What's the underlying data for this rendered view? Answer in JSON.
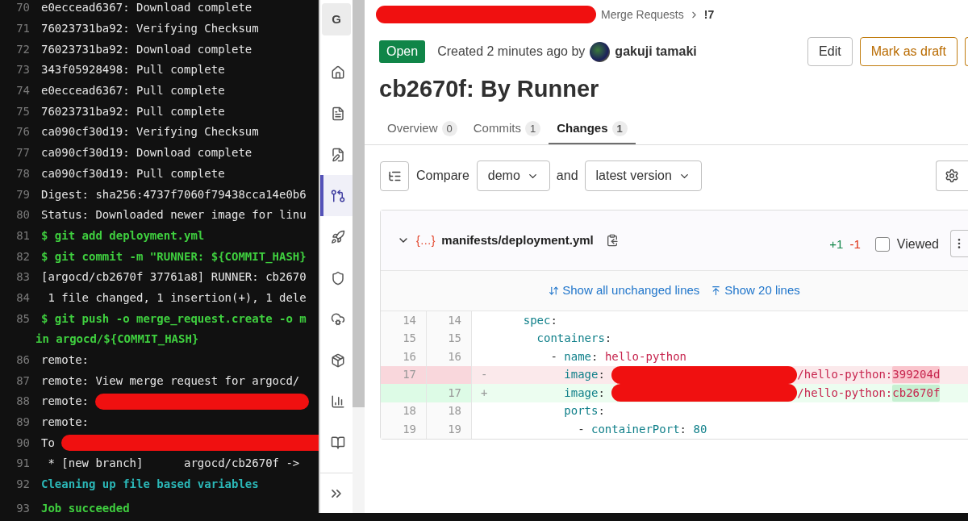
{
  "terminal": {
    "lines": [
      {
        "number": "70",
        "text": "e0eccead6367: Download complete",
        "kind": "plain"
      },
      {
        "number": "71",
        "text": "76023731ba92: Verifying Checksum",
        "kind": "plain"
      },
      {
        "number": "72",
        "text": "76023731ba92: Download complete",
        "kind": "plain"
      },
      {
        "number": "73",
        "text": "343f05928498: Pull complete",
        "kind": "plain"
      },
      {
        "number": "74",
        "text": "e0eccead6367: Pull complete",
        "kind": "plain"
      },
      {
        "number": "75",
        "text": "76023731ba92: Pull complete",
        "kind": "plain"
      },
      {
        "number": "76",
        "text": "ca090cf30d19: Verifying Checksum",
        "kind": "plain"
      },
      {
        "number": "77",
        "text": "ca090cf30d19: Download complete",
        "kind": "plain"
      },
      {
        "number": "78",
        "text": "ca090cf30d19: Pull complete",
        "kind": "plain"
      },
      {
        "number": "79",
        "text": "Digest: sha256:4737f7060f79438cca14e0b6",
        "kind": "plain"
      },
      {
        "number": "80",
        "text": "Status: Downloaded newer image for linu",
        "kind": "plain"
      },
      {
        "number": "81",
        "text": "$ git add deployment.yml",
        "kind": "command"
      },
      {
        "number": "82",
        "text": "$ git commit -m \"RUNNER: ${COMMIT_HASH}",
        "kind": "command"
      },
      {
        "number": "83",
        "text": "[argocd/cb2670f 37761a8] RUNNER: cb2670",
        "kind": "plain"
      },
      {
        "number": "84",
        "text": " 1 file changed, 1 insertion(+), 1 dele",
        "kind": "plain"
      },
      {
        "number": "85",
        "text": "$ git push -o merge_request.create -o m",
        "kind": "command",
        "continuation": "in argocd/${COMMIT_HASH}"
      },
      {
        "number": "86",
        "text": "remote:",
        "kind": "plain"
      },
      {
        "number": "87",
        "text": "remote: View merge request for argocd/",
        "kind": "plain"
      },
      {
        "number": "88",
        "text": "remote:",
        "kind": "plain",
        "redacted": true
      },
      {
        "number": "89",
        "text": "remote:",
        "kind": "plain"
      },
      {
        "number": "90",
        "text": "To",
        "kind": "plain",
        "redacted": true
      },
      {
        "number": "91",
        "text": " * [new branch]      argocd/cb2670f ->",
        "kind": "plain"
      },
      {
        "number": "92",
        "text": "Cleaning up file based variables",
        "kind": "section"
      },
      {
        "number": "93",
        "text": "Job succeeded",
        "kind": "success"
      }
    ]
  },
  "sidebar": {
    "logo": "G",
    "items": [
      {
        "selected": false
      },
      {
        "selected": false
      },
      {
        "selected": false
      },
      {
        "selected": true
      },
      {
        "selected": false
      },
      {
        "selected": false
      },
      {
        "selected": false
      },
      {
        "selected": false
      },
      {
        "selected": false
      },
      {
        "selected": false
      }
    ]
  },
  "breadcrumb": {
    "redacted": true,
    "items": [
      "Merge Requests",
      "!7"
    ]
  },
  "merge_request": {
    "status": "Open",
    "created": "Created 2 minutes ago by",
    "author": "gakuji tamaki",
    "title": "cb2670f: By Runner",
    "buttons": [
      {
        "label": "Edit",
        "kind": "default"
      },
      {
        "label": "Mark as draft",
        "kind": "warning"
      }
    ]
  },
  "tabs": [
    {
      "label": "Overview",
      "count": "0",
      "selected": false
    },
    {
      "label": "Commits",
      "count": "1",
      "selected": false
    },
    {
      "label": "Changes",
      "count": "1",
      "selected": true
    }
  ],
  "compare": {
    "label": "Compare",
    "base": "demo",
    "joiner": "and",
    "head": "latest version"
  },
  "file": {
    "icon": "{…}",
    "path": "manifests/deployment.yml",
    "added": "+1",
    "removed": "-1",
    "viewed": {
      "label": "Viewed",
      "checked": false
    },
    "expand_links": [
      "Show all unchanged lines",
      "Show 20 lines"
    ],
    "lines": [
      {
        "old": "14",
        "new": "14",
        "kind": "context",
        "segments": [
          {
            "text": "    spec",
            "kind": "key"
          },
          {
            "text": ":",
            "kind": "plain"
          }
        ]
      },
      {
        "old": "15",
        "new": "15",
        "kind": "context",
        "segments": [
          {
            "text": "      containers",
            "kind": "key"
          },
          {
            "text": ":",
            "kind": "plain"
          }
        ]
      },
      {
        "old": "16",
        "new": "16",
        "kind": "context",
        "segments": [
          {
            "text": "        - ",
            "kind": "plain"
          },
          {
            "text": "name",
            "kind": "key"
          },
          {
            "text": ": ",
            "kind": "plain"
          },
          {
            "text": "hello-python",
            "kind": "value"
          }
        ]
      },
      {
        "old": "17",
        "kind": "removed",
        "sign": "-",
        "segments": [
          {
            "text": "          image",
            "kind": "key"
          },
          {
            "text": ": ",
            "kind": "plain"
          },
          {
            "kind": "redacted"
          },
          {
            "text": "/hello-python:",
            "kind": "value"
          },
          {
            "text": "399204d",
            "kind": "changed"
          }
        ]
      },
      {
        "new": "17",
        "kind": "added",
        "sign": "+",
        "segments": [
          {
            "text": "          image",
            "kind": "key"
          },
          {
            "text": ": ",
            "kind": "plain"
          },
          {
            "kind": "redacted"
          },
          {
            "text": "/hello-python:",
            "kind": "value"
          },
          {
            "text": "cb2670f",
            "kind": "changed"
          }
        ]
      },
      {
        "old": "18",
        "new": "18",
        "kind": "context",
        "segments": [
          {
            "text": "          ports",
            "kind": "key"
          },
          {
            "text": ":",
            "kind": "plain"
          }
        ]
      },
      {
        "old": "19",
        "new": "19",
        "kind": "context",
        "segments": [
          {
            "text": "            - ",
            "kind": "plain"
          },
          {
            "text": "containerPort",
            "kind": "key"
          },
          {
            "text": ": ",
            "kind": "plain"
          },
          {
            "text": "80",
            "kind": "number"
          }
        ]
      }
    ]
  }
}
